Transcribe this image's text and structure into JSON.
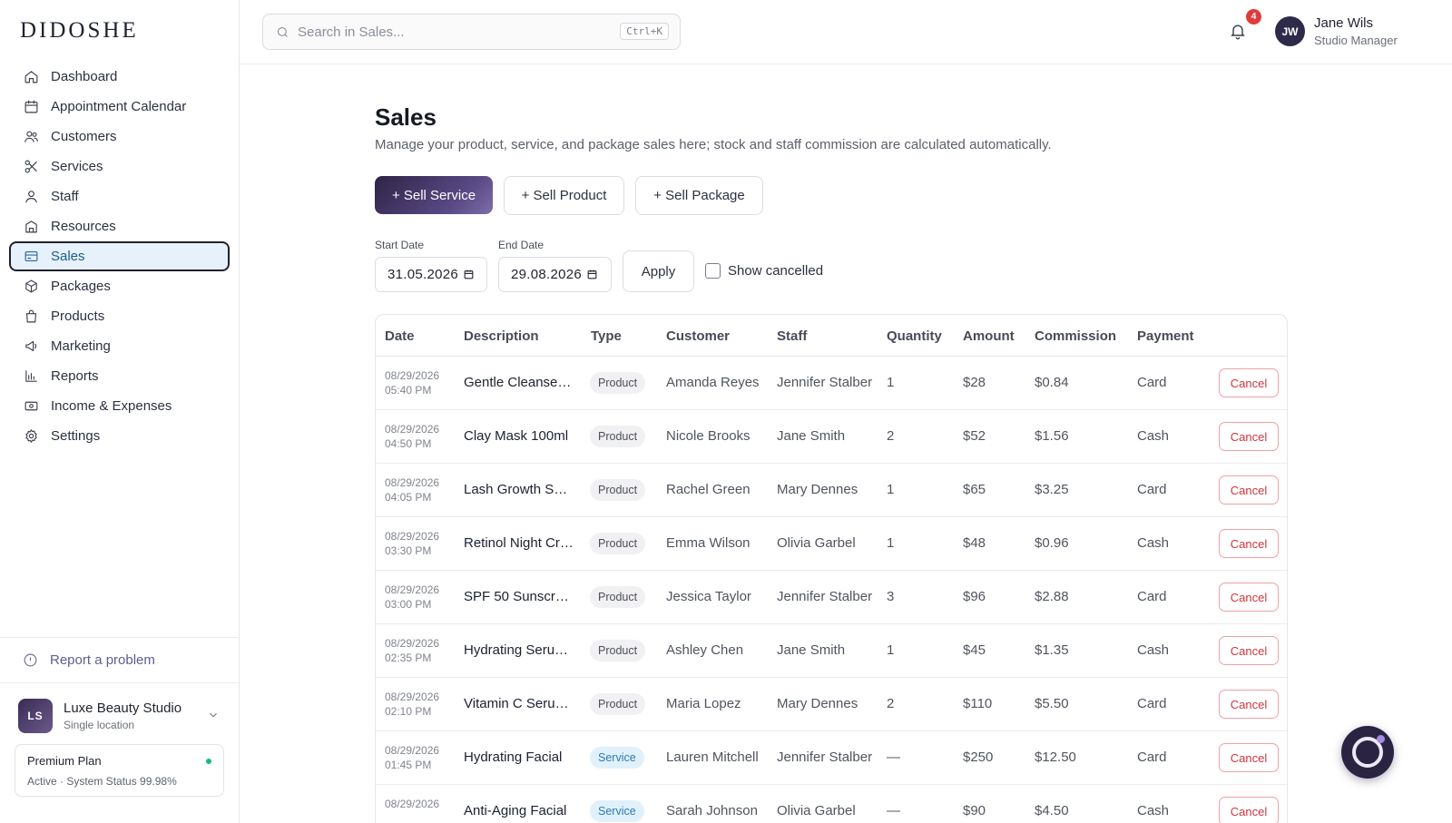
{
  "brand": {
    "logo": "DIDOSHE"
  },
  "sidebar": {
    "items": [
      {
        "label": "Dashboard",
        "icon": "home-icon"
      },
      {
        "label": "Appointment Calendar",
        "icon": "calendar-icon"
      },
      {
        "label": "Customers",
        "icon": "users-icon"
      },
      {
        "label": "Services",
        "icon": "scissors-icon"
      },
      {
        "label": "Staff",
        "icon": "user-icon"
      },
      {
        "label": "Resources",
        "icon": "building-icon"
      },
      {
        "label": "Sales",
        "icon": "credit-card-icon",
        "active": true
      },
      {
        "label": "Packages",
        "icon": "box-icon"
      },
      {
        "label": "Products",
        "icon": "bag-icon"
      },
      {
        "label": "Marketing",
        "icon": "megaphone-icon"
      },
      {
        "label": "Reports",
        "icon": "bar-chart-icon"
      },
      {
        "label": "Income & Expenses",
        "icon": "cash-icon"
      },
      {
        "label": "Settings",
        "icon": "gear-icon"
      }
    ],
    "report_problem": "Report a problem",
    "studio": {
      "initials": "LS",
      "name": "Luxe Beauty Studio",
      "subtitle": "Single location"
    },
    "plan": {
      "title": "Premium Plan",
      "status": "Active · System Status 99.98%",
      "status_color": "#16b98a"
    }
  },
  "topbar": {
    "search_placeholder": "Search in Sales...",
    "search_shortcut": "Ctrl+K",
    "notifications_count": "4",
    "user": {
      "initials": "JW",
      "name": "Jane Wils",
      "role": "Studio Manager"
    }
  },
  "main": {
    "title": "Sales",
    "description": "Manage your product, service, and package sales here; stock and staff commission are calculated automatically.",
    "actions": {
      "sell_service": "+ Sell Service",
      "sell_product": "+ Sell Product",
      "sell_package": "+ Sell Package"
    },
    "filters": {
      "start_label": "Start Date",
      "start_value": "31.05.2026",
      "end_label": "End Date",
      "end_value": "29.08.2026",
      "apply": "Apply",
      "show_cancelled": "Show cancelled"
    },
    "table": {
      "headers": [
        "Date",
        "Description",
        "Type",
        "Customer",
        "Staff",
        "Quantity",
        "Amount",
        "Commission",
        "Payment"
      ],
      "cancel_label": "Cancel",
      "rows": [
        {
          "date": "08/29/2026",
          "time": "05:40 PM",
          "desc": "Gentle Cleanse…",
          "type": "Product",
          "customer": "Amanda Reyes",
          "staff": "Jennifer Stalber",
          "qty": "1",
          "amount": "$28",
          "commission": "$0.84",
          "payment": "Card"
        },
        {
          "date": "08/29/2026",
          "time": "04:50 PM",
          "desc": "Clay Mask 100ml",
          "type": "Product",
          "customer": "Nicole Brooks",
          "staff": "Jane Smith",
          "qty": "2",
          "amount": "$52",
          "commission": "$1.56",
          "payment": "Cash"
        },
        {
          "date": "08/29/2026",
          "time": "04:05 PM",
          "desc": "Lash Growth Se…",
          "type": "Product",
          "customer": "Rachel Green",
          "staff": "Mary Dennes",
          "qty": "1",
          "amount": "$65",
          "commission": "$3.25",
          "payment": "Card"
        },
        {
          "date": "08/29/2026",
          "time": "03:30 PM",
          "desc": "Retinol Night Cr…",
          "type": "Product",
          "customer": "Emma Wilson",
          "staff": "Olivia Garbel",
          "qty": "1",
          "amount": "$48",
          "commission": "$0.96",
          "payment": "Cash"
        },
        {
          "date": "08/29/2026",
          "time": "03:00 PM",
          "desc": "SPF 50 Sunscr…",
          "type": "Product",
          "customer": "Jessica Taylor",
          "staff": "Jennifer Stalber",
          "qty": "3",
          "amount": "$96",
          "commission": "$2.88",
          "payment": "Card"
        },
        {
          "date": "08/29/2026",
          "time": "02:35 PM",
          "desc": "Hydrating Seru…",
          "type": "Product",
          "customer": "Ashley Chen",
          "staff": "Jane Smith",
          "qty": "1",
          "amount": "$45",
          "commission": "$1.35",
          "payment": "Cash"
        },
        {
          "date": "08/29/2026",
          "time": "02:10 PM",
          "desc": "Vitamin C Seru…",
          "type": "Product",
          "customer": "Maria Lopez",
          "staff": "Mary Dennes",
          "qty": "2",
          "amount": "$110",
          "commission": "$5.50",
          "payment": "Card"
        },
        {
          "date": "08/29/2026",
          "time": "01:45 PM",
          "desc": "Hydrating Facial",
          "type": "Service",
          "customer": "Lauren Mitchell",
          "staff": "Jennifer Stalber",
          "qty": "—",
          "amount": "$250",
          "commission": "$12.50",
          "payment": "Card"
        },
        {
          "date": "08/29/2026",
          "time": "",
          "desc": "Anti-Aging Facial",
          "type": "Service",
          "customer": "Sarah Johnson",
          "staff": "Olivia Garbel",
          "qty": "—",
          "amount": "$90",
          "commission": "$4.50",
          "payment": "Cash"
        }
      ]
    }
  },
  "colors": {
    "accent": "#2e2446",
    "active_nav_bg": "#e6f1fb",
    "cancel_red": "#d1343f",
    "badge_red": "#e23b3b"
  }
}
